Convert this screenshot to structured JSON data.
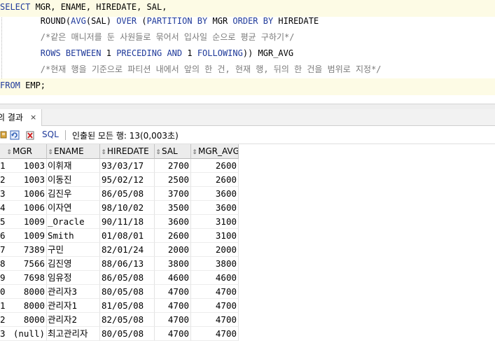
{
  "editor": {
    "lines": [
      {
        "parts": [
          {
            "t": "SELECT",
            "k": "kw"
          },
          {
            "t": " MGR, ENAME, HIREDATE, SAL,",
            "k": ""
          }
        ]
      },
      {
        "parts": [
          {
            "t": "        ROUND(",
            "k": ""
          },
          {
            "t": "AVG",
            "k": "kw"
          },
          {
            "t": "(SAL) ",
            "k": ""
          },
          {
            "t": "OVER",
            "k": "kw"
          },
          {
            "t": " (",
            "k": ""
          },
          {
            "t": "PARTITION BY",
            "k": "kw"
          },
          {
            "t": " MGR ",
            "k": ""
          },
          {
            "t": "ORDER BY",
            "k": "kw"
          },
          {
            "t": " HIREDATE",
            "k": ""
          }
        ]
      },
      {
        "parts": [
          {
            "t": "        /*같은 매니저를 둔 사원들로 묶어서 입사일 순으로 평균 구하기*/",
            "k": "cm"
          }
        ]
      },
      {
        "parts": [
          {
            "t": "        ",
            "k": ""
          },
          {
            "t": "ROWS BETWEEN",
            "k": "kw"
          },
          {
            "t": " 1 ",
            "k": ""
          },
          {
            "t": "PRECEDING",
            "k": "kw"
          },
          {
            "t": " ",
            "k": ""
          },
          {
            "t": "AND",
            "k": "kw"
          },
          {
            "t": " 1 ",
            "k": ""
          },
          {
            "t": "FOLLOWING",
            "k": "kw"
          },
          {
            "t": ")) MGR_AVG",
            "k": ""
          }
        ]
      },
      {
        "parts": [
          {
            "t": "        /*현재 행을 기준으로 파티션 내에서 앞의 한 건, 현재 행, 뒤의 한 건을 범위로 지정*/",
            "k": "cm"
          }
        ]
      },
      {
        "parts": [
          {
            "t": "FROM",
            "k": "kw"
          },
          {
            "t": " EMP;",
            "k": ""
          }
        ]
      }
    ]
  },
  "result_tab": {
    "label": "의 결과",
    "close": "×"
  },
  "toolbar": {
    "sql_label": "SQL",
    "status": "인출된 모든 행: 13(0,003초)",
    "icons": [
      "pin-icon",
      "refresh-icon",
      "export-icon"
    ]
  },
  "grid": {
    "columns": [
      "MGR",
      "ENAME",
      "HIREDATE",
      "SAL",
      "MGR_AVG"
    ],
    "rows": [
      {
        "rn": "1",
        "mgr": "1003",
        "ename": "이휘재",
        "hiredate": "93/03/17",
        "sal": "2700",
        "avg": "2600"
      },
      {
        "rn": "2",
        "mgr": "1003",
        "ename": "이동진",
        "hiredate": "95/02/12",
        "sal": "2500",
        "avg": "2600"
      },
      {
        "rn": "3",
        "mgr": "1006",
        "ename": "김진우",
        "hiredate": "86/05/08",
        "sal": "3700",
        "avg": "3600"
      },
      {
        "rn": "4",
        "mgr": "1006",
        "ename": "이자연",
        "hiredate": "98/10/02",
        "sal": "3500",
        "avg": "3600"
      },
      {
        "rn": "5",
        "mgr": "1009",
        "ename": "_Oracle",
        "hiredate": "90/11/18",
        "sal": "3600",
        "avg": "3100"
      },
      {
        "rn": "6",
        "mgr": "1009",
        "ename": "Smith",
        "hiredate": "01/08/01",
        "sal": "2600",
        "avg": "3100"
      },
      {
        "rn": "7",
        "mgr": "7389",
        "ename": "구민",
        "hiredate": "82/01/24",
        "sal": "2000",
        "avg": "2000"
      },
      {
        "rn": "8",
        "mgr": "7566",
        "ename": "김진영",
        "hiredate": "88/06/13",
        "sal": "3800",
        "avg": "3800"
      },
      {
        "rn": "9",
        "mgr": "7698",
        "ename": "임유정",
        "hiredate": "86/05/08",
        "sal": "4600",
        "avg": "4600"
      },
      {
        "rn": "0",
        "mgr": "8000",
        "ename": "관리자3",
        "hiredate": "80/05/08",
        "sal": "4700",
        "avg": "4700"
      },
      {
        "rn": "1",
        "mgr": "8000",
        "ename": "관리자1",
        "hiredate": "81/05/08",
        "sal": "4700",
        "avg": "4700"
      },
      {
        "rn": "2",
        "mgr": "8000",
        "ename": "관리자2",
        "hiredate": "82/05/08",
        "sal": "4700",
        "avg": "4700"
      },
      {
        "rn": "3",
        "mgr": "(null)",
        "ename": "최고관리자",
        "hiredate": "80/05/08",
        "sal": "4700",
        "avg": "4700"
      }
    ]
  }
}
